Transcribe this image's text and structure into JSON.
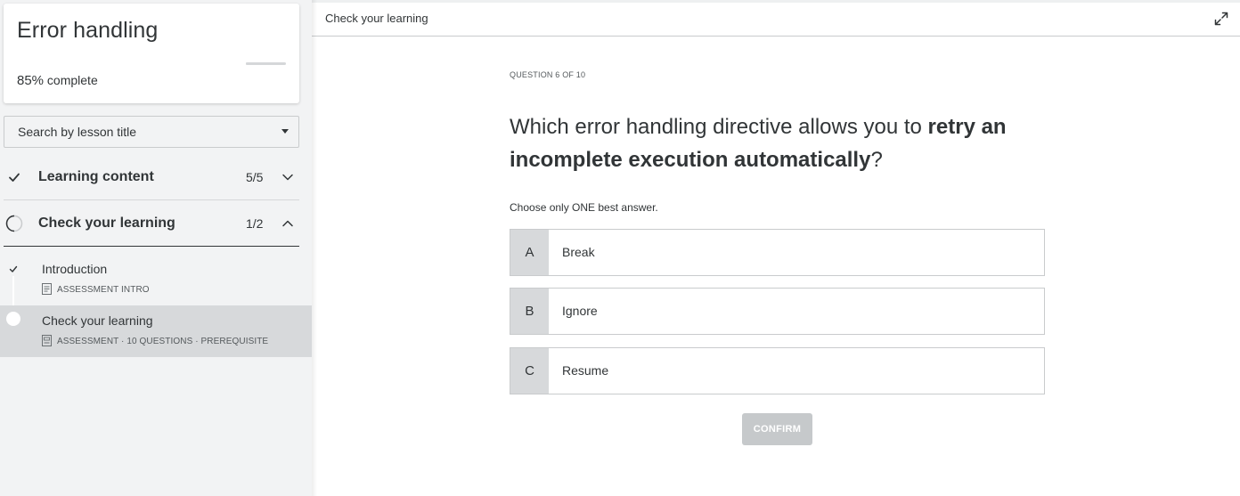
{
  "course": {
    "title": "Error handling",
    "progress_percent": "85%",
    "progress_suffix": "complete",
    "progress_bar_fraction": 0.85
  },
  "search": {
    "placeholder": "Search by lesson title"
  },
  "sections": [
    {
      "title": "Learning content",
      "count": "5/5",
      "status": "complete",
      "expanded": false
    },
    {
      "title": "Check your learning",
      "count": "1/2",
      "status": "in-progress",
      "expanded": true
    }
  ],
  "lessons": [
    {
      "title": "Introduction",
      "meta": "ASSESSMENT INTRO",
      "status": "complete",
      "active": false
    },
    {
      "title": "Check your learning",
      "meta": "ASSESSMENT · 10 QUESTIONS · PREREQUISITE",
      "status": "current",
      "active": true
    }
  ],
  "main": {
    "header_title": "Check your learning",
    "question_counter": "QUESTION 6 OF 10",
    "question_plain": "Which error handling directive allows you to ",
    "question_bold": "retry an incomplete execution automatically",
    "question_end": "?",
    "instruction": "Choose only ONE best answer.",
    "options": [
      {
        "letter": "A",
        "label": "Break"
      },
      {
        "letter": "B",
        "label": "Ignore"
      },
      {
        "letter": "C",
        "label": "Resume"
      }
    ],
    "confirm_label": "CONFIRM",
    "confirm_enabled": false
  },
  "icons": {
    "check": "check-icon",
    "chevron_down": "chevron-down-icon",
    "chevron_up": "chevron-up-icon",
    "expand": "expand-icon",
    "document": "document-icon"
  },
  "colors": {
    "text": "#313537",
    "sidebar_bg": "#f2f3f4",
    "active_row": "#d7d9db",
    "confirm_disabled": "#c6c9cb"
  }
}
